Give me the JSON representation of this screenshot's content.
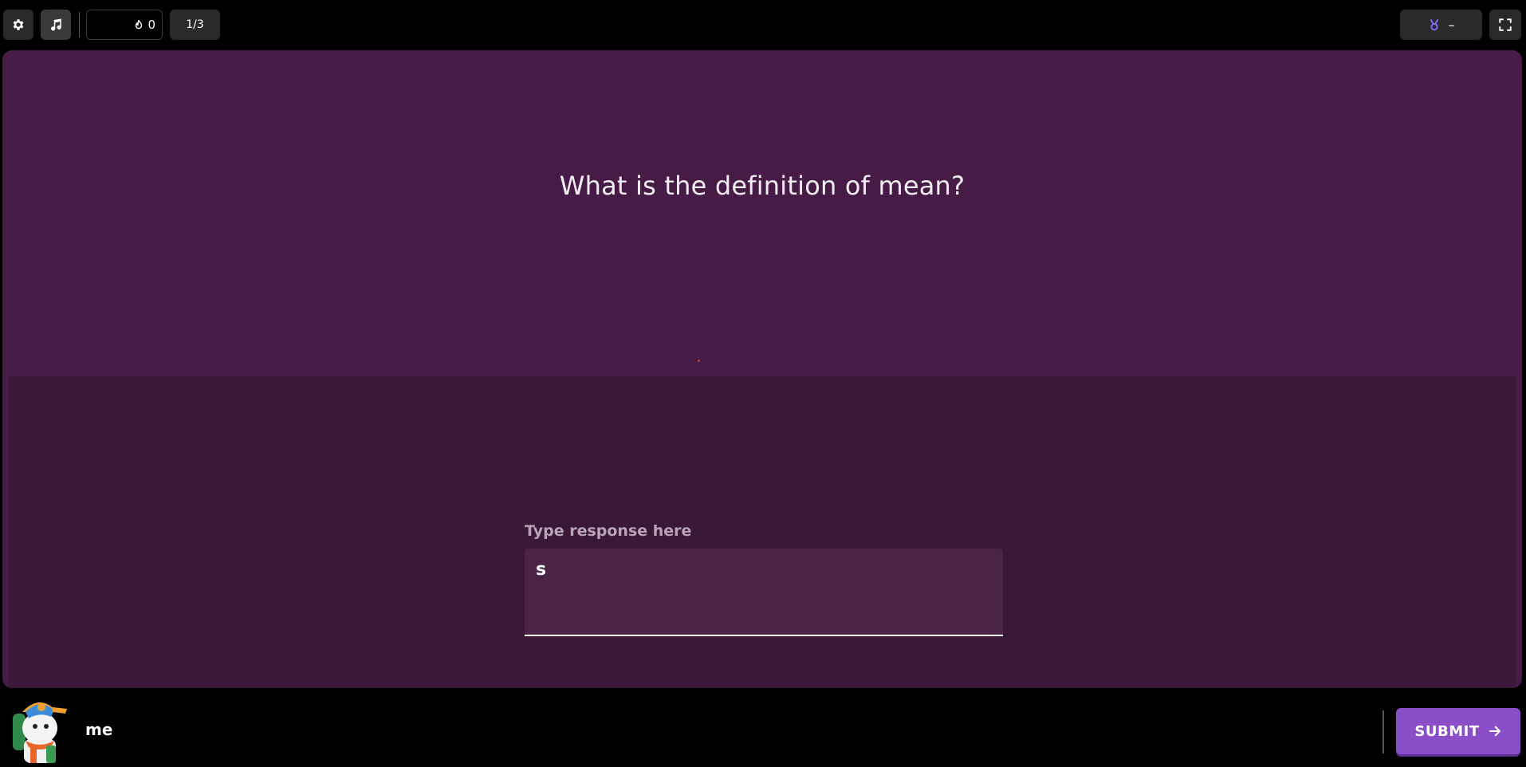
{
  "topbar": {
    "settings_icon": "gear-icon",
    "music_icon": "music-note-icon",
    "streak_icon": "flame-icon",
    "streak_count": "0",
    "progress": "1/3",
    "rank_icon": "medal-icon",
    "rank_value": "–",
    "fullscreen_icon": "fullscreen-icon"
  },
  "question": {
    "text": "What is the definition of mean?"
  },
  "response": {
    "label": "Type response here",
    "value": "s"
  },
  "player": {
    "name": "me"
  },
  "submit": {
    "label": "SUBMIT",
    "icon": "arrow-right-icon"
  },
  "colors": {
    "question_bg": "#461b45",
    "answer_bg": "#3a1837",
    "input_bg": "#4a2346",
    "submit_bg": "#8a4fc8",
    "medal_accent": "#7b6cf0"
  }
}
